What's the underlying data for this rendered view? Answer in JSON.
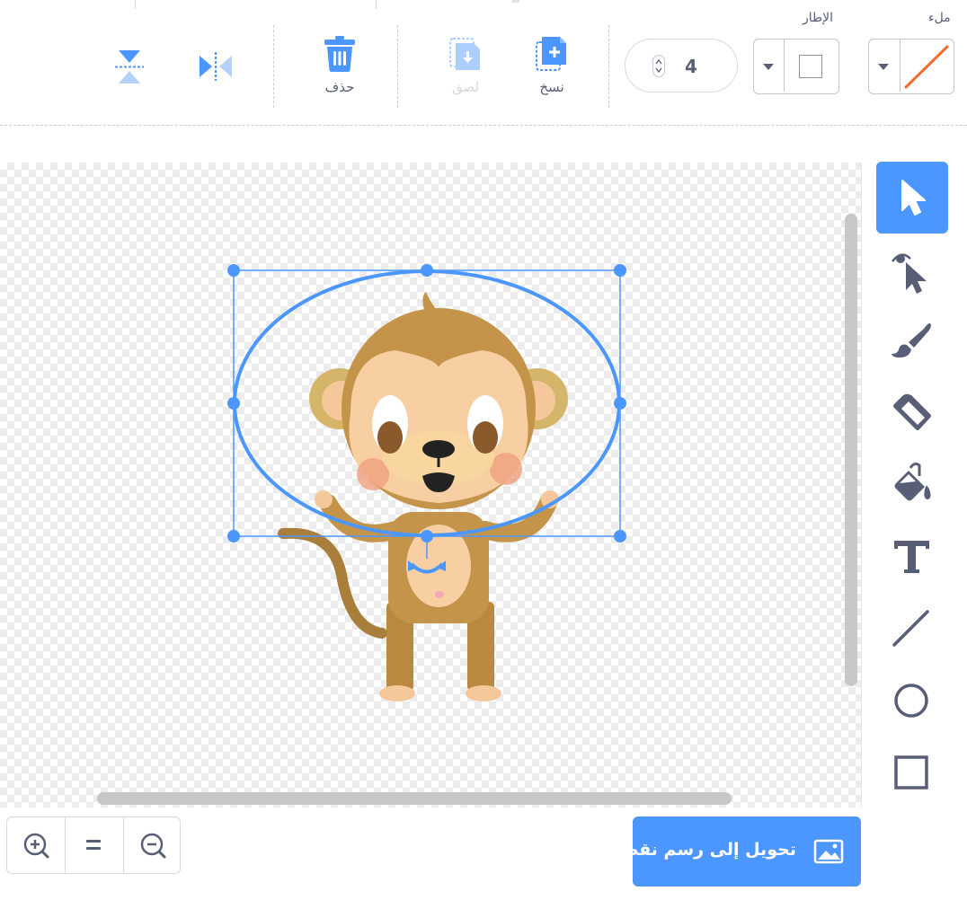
{
  "toolbar": {
    "fill_label": "ملء",
    "outline_label": "الإطار",
    "stroke_width": "4",
    "copy_label": "نسخ",
    "paste_label": "لصق",
    "delete_label": "حذف"
  },
  "colors": {
    "accent": "#4c97ff",
    "fill_line": "#f26b2e",
    "text": "#575e75",
    "disabled_text": "#a2a7b3",
    "selection": "#4c97ff"
  },
  "tools": [
    {
      "name": "select",
      "icon": "arrow-select-icon",
      "active": true
    },
    {
      "name": "reshape",
      "icon": "reshape-icon",
      "active": false
    },
    {
      "name": "brush",
      "icon": "brush-icon",
      "active": false
    },
    {
      "name": "eraser",
      "icon": "eraser-icon",
      "active": false
    },
    {
      "name": "fill",
      "icon": "fill-bucket-icon",
      "active": false
    },
    {
      "name": "text",
      "icon": "text-icon",
      "active": false
    },
    {
      "name": "line",
      "icon": "line-icon",
      "active": false
    },
    {
      "name": "circle",
      "icon": "circle-icon",
      "active": false
    },
    {
      "name": "rectangle",
      "icon": "rectangle-icon",
      "active": false
    }
  ],
  "bottom": {
    "convert_label": "تحويل إلى رسم نقطي"
  }
}
